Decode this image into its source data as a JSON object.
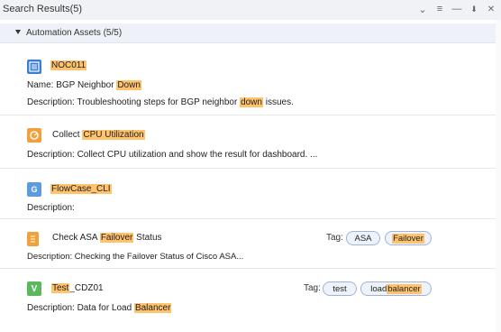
{
  "panel": {
    "title": "Search Results(5)",
    "controls": [
      {
        "name": "collapse-chevron-icon",
        "glyph": "⌄"
      },
      {
        "name": "menu-icon",
        "glyph": "≡"
      },
      {
        "name": "minimize-icon",
        "glyph": "—"
      },
      {
        "name": "pin-icon",
        "glyph": "⬇"
      },
      {
        "name": "close-icon",
        "glyph": "✕"
      }
    ]
  },
  "group": {
    "label": "Automation Assets (5/5)"
  },
  "results": [
    {
      "icon": "runbook-icon",
      "title_before": "",
      "title_hl": "NOC011",
      "title_after": "",
      "name_before": "Name: BGP Neighbor ",
      "name_hl": "Down",
      "name_after": "",
      "desc_before": "Description: Troubleshooting steps for BGP neighbor ",
      "desc_hl": "down",
      "desc_after": " issues."
    },
    {
      "icon": "dashboard-icon",
      "title_before": "Collect ",
      "title_hl": "CPU Utilization",
      "title_after": "",
      "desc_text": "Description: Collect CPU utilization and show the result for dashboard. ..."
    },
    {
      "icon": "flowcase-icon",
      "icon_letter": "G",
      "title_before": "",
      "title_hl": "FlowCase_CLI",
      "title_after": "",
      "desc_text": "Description:"
    },
    {
      "icon": "checklist-icon",
      "title_before": "Check ASA ",
      "title_hl": "Failover",
      "title_after": " Status",
      "tag_label": "Tag:",
      "tags": [
        "ASA",
        "Failover"
      ],
      "desc_text": "Description: Checking the Failover Status of Cisco ASA..."
    },
    {
      "icon": "verify-icon",
      "icon_letter": "V",
      "title_before": "",
      "title_hl": "Test",
      "title_after": "_CDZ01",
      "tag_label": "Tag:",
      "tags": [
        "test",
        "load balancer"
      ],
      "tag2_before": "load ",
      "tag2_hl": "balancer",
      "desc_before": "Description: Data for Load ",
      "desc_hl": "Balancer",
      "desc_after": ""
    }
  ]
}
